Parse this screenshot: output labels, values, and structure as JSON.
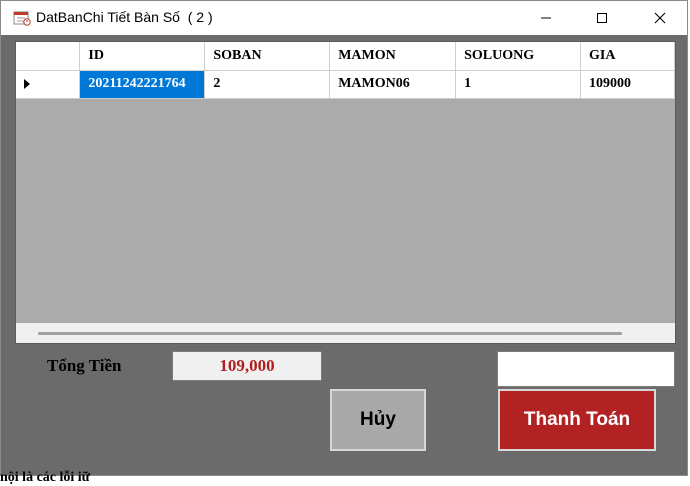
{
  "window": {
    "title": "DatBanChi Tiết Bàn Số  ( 2 )",
    "controls": {
      "minimize": "minimize-icon",
      "maximize": "maximize-icon",
      "close": "close-icon"
    }
  },
  "grid": {
    "columns": [
      "ID",
      "SOBAN",
      "MAMON",
      "SOLUONG",
      "GIA"
    ],
    "rows": [
      {
        "id": "20211242221764",
        "soban": "2",
        "mamon": "MAMON06",
        "soluong": "1",
        "gia": "109000"
      }
    ],
    "selection_color": "#0078d7"
  },
  "footer": {
    "total_label": "Tổng Tiền",
    "total_value": "109,000",
    "total_color": "#b11d1d",
    "extra_input_value": "",
    "cancel_label": "Hủy",
    "pay_label": "Thanh Toán",
    "pay_color": "#b22222"
  },
  "background_text": "nội là các lỗi iữ"
}
